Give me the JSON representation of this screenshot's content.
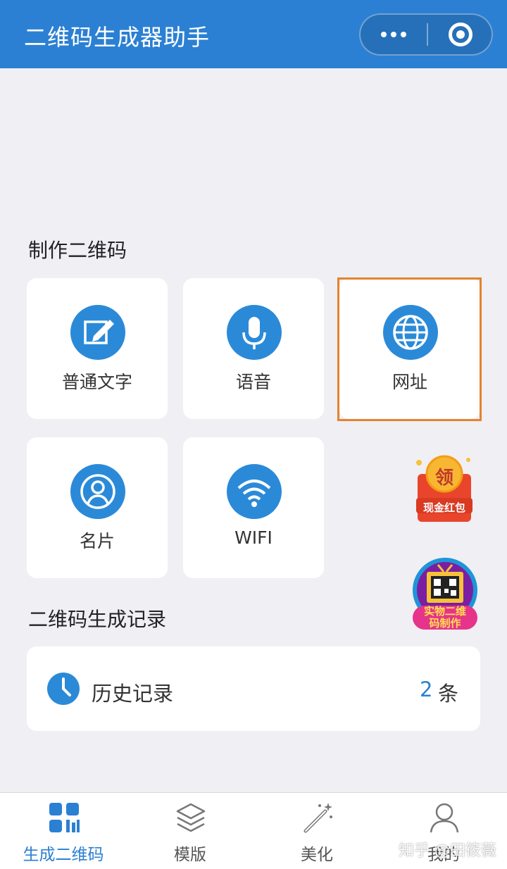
{
  "header": {
    "title": "二维码生成器助手",
    "more_icon": "more-dots-icon",
    "close_icon": "mini-program-close-icon",
    "bg_color": "#2b80d3"
  },
  "make_section": {
    "title": "制作二维码",
    "tiles": [
      {
        "label": "普通文字",
        "icon": "edit-icon"
      },
      {
        "label": "语音",
        "icon": "microphone-icon"
      },
      {
        "label": "网址",
        "icon": "globe-icon",
        "highlighted": true
      },
      {
        "label": "名片",
        "icon": "user-card-icon"
      },
      {
        "label": "WIFI",
        "icon": "wifi-icon"
      }
    ],
    "highlight_color": "#e4832e"
  },
  "promos": {
    "red_packet": {
      "badge": "领",
      "label": "现金红包"
    },
    "tv": {
      "label_line1": "实物二维",
      "label_line2": "码制作"
    }
  },
  "records_section": {
    "title": "二维码生成记录",
    "history": {
      "icon": "clock-icon",
      "label": "历史记录",
      "count": "2",
      "unit": "条"
    }
  },
  "tabbar": {
    "tabs": [
      {
        "label": "生成二维码",
        "icon": "qr-grid-icon",
        "active": true
      },
      {
        "label": "模版",
        "icon": "layers-icon"
      },
      {
        "label": "美化",
        "icon": "magic-wand-icon"
      },
      {
        "label": "我的",
        "icon": "user-icon"
      }
    ],
    "active_color": "#2b80d3"
  },
  "watermark": "知乎 @田筱薇"
}
